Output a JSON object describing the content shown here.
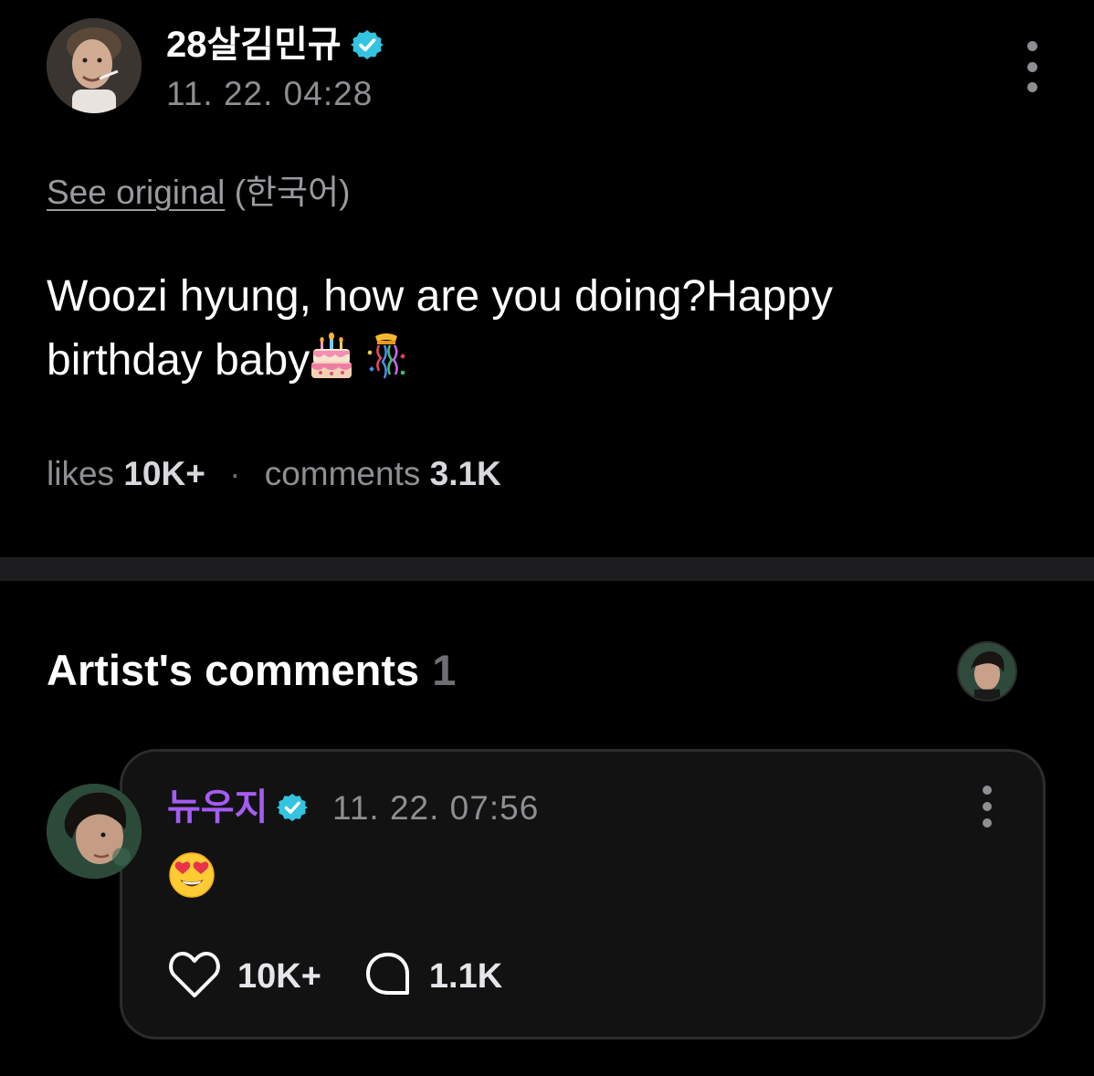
{
  "post": {
    "author": {
      "name": "28살김민규",
      "verified": true,
      "avatar_icon": "profile-photo"
    },
    "timestamp": "11. 22. 04:28",
    "more_icon": "more-vertical-icon",
    "translation": {
      "see_original_label": "See original",
      "language": "(한국어)"
    },
    "text_line1": "Woozi hyung, how are you doing?Happy",
    "text_line2": "birthday baby",
    "emojis": [
      "birthday-cake-icon",
      "confetti-icon"
    ],
    "stats": {
      "likes_label": "likes",
      "likes_value": "10K+",
      "separator": "·",
      "comments_label": "comments",
      "comments_value": "3.1K"
    }
  },
  "artist_comments": {
    "title": "Artist's comments",
    "count": "1",
    "comment": {
      "author": "뉴우지",
      "author_color": "#a45cf2",
      "verified": true,
      "timestamp": "11. 22. 07:56",
      "content_emoji": "heart-eyes-emoji-icon",
      "likes": "10K+",
      "replies": "1.1K"
    }
  },
  "colors": {
    "background": "#000000",
    "verified_badge": "#34c3e0",
    "muted_text": "#8e8e93",
    "card_border": "#2c2c2e",
    "artist_name": "#a45cf2"
  }
}
